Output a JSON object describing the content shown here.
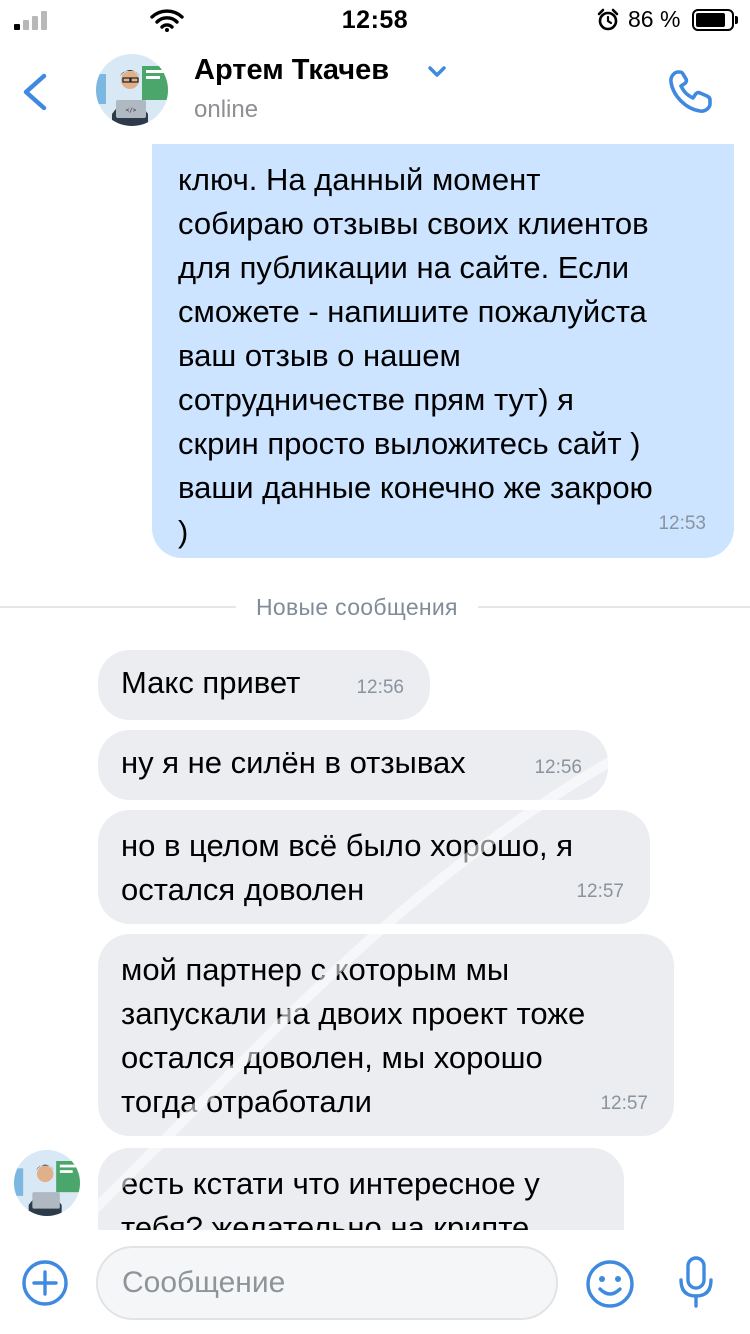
{
  "status_bar": {
    "time": "12:58",
    "battery_percent": "86 %",
    "battery_level": 0.86,
    "signal_icon": "signal-icon",
    "wifi_icon": "wifi-icon",
    "alarm_icon": "alarm-icon"
  },
  "header": {
    "back_icon": "chevron-left-icon",
    "contact_name": "Артем Ткачев",
    "status": "online",
    "call_icon": "phone-icon",
    "accent_color": "#3f8ae0"
  },
  "messages": {
    "outgoing": {
      "text": "ключ. На данный момент\nсобираю отзывы своих клиентов\nдля публикации на сайте. Если\nсможете - напишите пожалуйста\nваш отзыв о нашем\nсотрудничестве прям тут) я\nскрин просто выложитесь сайт )\nваши данные конечно же закрою\n)",
      "time": "12:53",
      "bubble_color": "#cce4ff"
    },
    "divider_label": "Новые сообщения",
    "incoming": [
      {
        "text": "Макс привет",
        "time": "12:56"
      },
      {
        "text": "ну я не силён в отзывах",
        "time": "12:56"
      },
      {
        "text": "но в целом всё было хорошо, я\nостался доволен",
        "time": "12:57"
      },
      {
        "text": "мой партнер с которым мы\nзапускали на двоих проект тоже\nостался доволен, мы хорошо\nтогда отработали",
        "time": "12:57"
      },
      {
        "text": "есть кстати что интересное у\nтебя? желательно на крипте"
      }
    ],
    "incoming_bubble_color": "#ebedf0"
  },
  "input_bar": {
    "placeholder": "Сообщение",
    "add_icon": "plus-circle-icon",
    "emoji_icon": "smile-icon",
    "mic_icon": "microphone-icon"
  }
}
